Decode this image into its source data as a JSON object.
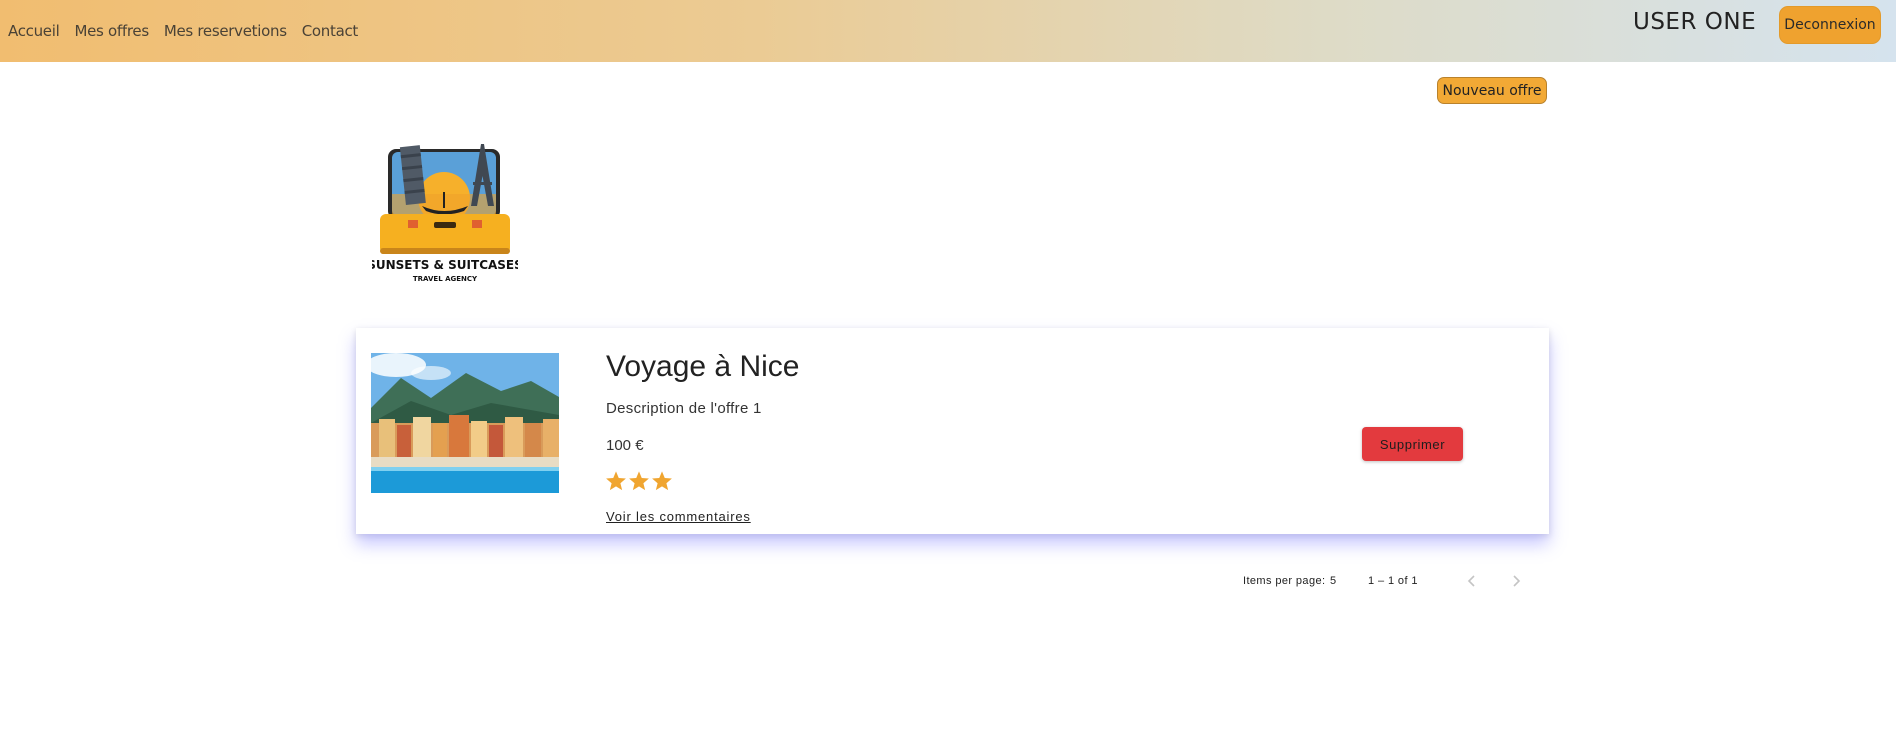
{
  "nav": {
    "items": [
      {
        "label": "Accueil"
      },
      {
        "label": "Mes offres"
      },
      {
        "label": "Mes reservetions"
      },
      {
        "label": "Contact"
      }
    ]
  },
  "header": {
    "user_name": "USER ONE",
    "logout_label": "Deconnexion"
  },
  "toolbar": {
    "new_offer_label": "Nouveau offre"
  },
  "logo": {
    "name": "SUNSETS & SUITCASES",
    "tagline": "TRAVEL AGENCY"
  },
  "offers": [
    {
      "title": "Voyage à Nice",
      "description": "Description de l'offre 1",
      "price": "100 €",
      "rating": 3,
      "comments_label": "Voir les commentaires",
      "delete_label": "Supprimer",
      "image_icon": "nice-city-photo"
    }
  ],
  "paginator": {
    "items_per_page_label": "Items per page:",
    "items_per_page_value": "5",
    "range_label": "1 – 1 of 1",
    "prev_icon": "chevron-left-icon",
    "next_icon": "chevron-right-icon"
  },
  "colors": {
    "accent": "#efa22f",
    "danger": "#e33a3e",
    "star": "#f0a530"
  }
}
